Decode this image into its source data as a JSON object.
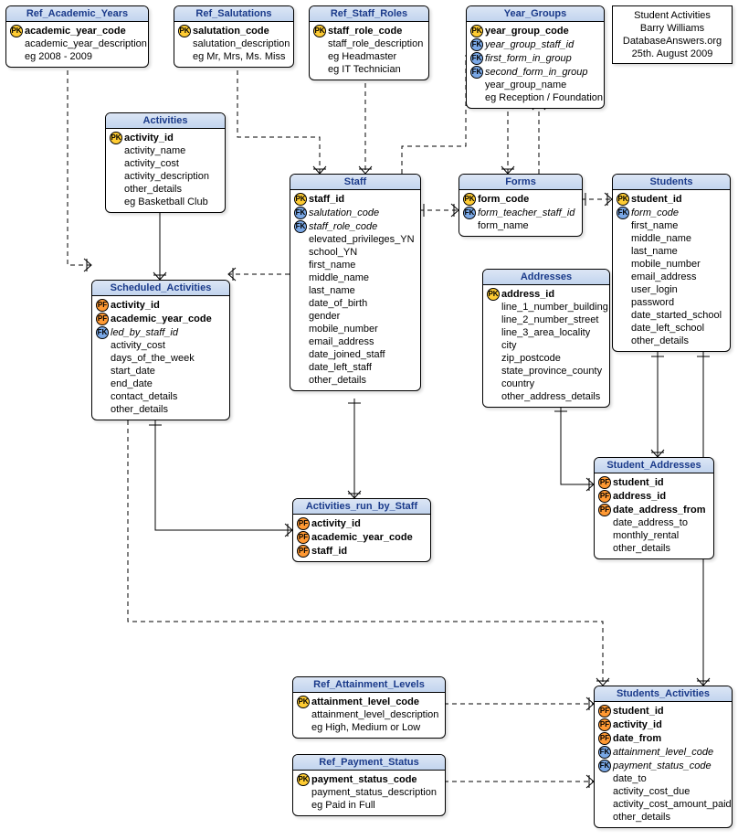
{
  "meta": {
    "line1": "Student Activities",
    "line2": "Barry Williams",
    "line3": "DatabaseAnswers.org",
    "line4": "25th. August 2009"
  },
  "entities": {
    "ref_academic_years": {
      "title": "Ref_Academic_Years",
      "fields": [
        {
          "key": "pk",
          "name": "academic_year_code",
          "bold": true
        },
        {
          "key": "",
          "name": "academic_year_description"
        },
        {
          "key": "",
          "name": "eg 2008 - 2009"
        }
      ]
    },
    "ref_salutations": {
      "title": "Ref_Salutations",
      "fields": [
        {
          "key": "pk",
          "name": "salutation_code",
          "bold": true
        },
        {
          "key": "",
          "name": "salutation_description"
        },
        {
          "key": "",
          "name": "eg Mr, Mrs, Ms. Miss"
        }
      ]
    },
    "ref_staff_roles": {
      "title": "Ref_Staff_Roles",
      "fields": [
        {
          "key": "pk",
          "name": "staff_role_code",
          "bold": true
        },
        {
          "key": "",
          "name": "staff_role_description"
        },
        {
          "key": "",
          "name": "eg Headmaster"
        },
        {
          "key": "",
          "name": "eg IT Technician"
        }
      ]
    },
    "year_groups": {
      "title": "Year_Groups",
      "fields": [
        {
          "key": "pk",
          "name": "year_group_code",
          "bold": true
        },
        {
          "key": "fk",
          "name": "year_group_staff_id",
          "italic": true
        },
        {
          "key": "fk",
          "name": "first_form_in_group",
          "italic": true
        },
        {
          "key": "fk",
          "name": "second_form_in_group",
          "italic": true
        },
        {
          "key": "",
          "name": "year_group_name"
        },
        {
          "key": "",
          "name": "eg Reception / Foundation"
        }
      ]
    },
    "activities": {
      "title": "Activities",
      "fields": [
        {
          "key": "pk",
          "name": "activity_id",
          "bold": true
        },
        {
          "key": "",
          "name": "activity_name"
        },
        {
          "key": "",
          "name": "activity_cost"
        },
        {
          "key": "",
          "name": "activity_description"
        },
        {
          "key": "",
          "name": "other_details"
        },
        {
          "key": "",
          "name": "eg Basketball Club"
        }
      ]
    },
    "staff": {
      "title": "Staff",
      "fields": [
        {
          "key": "pk",
          "name": "staff_id",
          "bold": true
        },
        {
          "key": "fk",
          "name": "salutation_code",
          "italic": true
        },
        {
          "key": "fk",
          "name": "staff_role_code",
          "italic": true
        },
        {
          "key": "",
          "name": "elevated_privileges_YN"
        },
        {
          "key": "",
          "name": "school_YN"
        },
        {
          "key": "",
          "name": "first_name"
        },
        {
          "key": "",
          "name": "middle_name"
        },
        {
          "key": "",
          "name": "last_name"
        },
        {
          "key": "",
          "name": "date_of_birth"
        },
        {
          "key": "",
          "name": "gender"
        },
        {
          "key": "",
          "name": "mobile_number"
        },
        {
          "key": "",
          "name": "email_address"
        },
        {
          "key": "",
          "name": "date_joined_staff"
        },
        {
          "key": "",
          "name": "date_left_staff"
        },
        {
          "key": "",
          "name": "other_details"
        }
      ]
    },
    "forms": {
      "title": "Forms",
      "fields": [
        {
          "key": "pk",
          "name": "form_code",
          "bold": true
        },
        {
          "key": "fk",
          "name": "form_teacher_staff_id",
          "italic": true
        },
        {
          "key": "",
          "name": "form_name"
        }
      ]
    },
    "students": {
      "title": "Students",
      "fields": [
        {
          "key": "pk",
          "name": "student_id",
          "bold": true
        },
        {
          "key": "fk",
          "name": "form_code",
          "italic": true
        },
        {
          "key": "",
          "name": "first_name"
        },
        {
          "key": "",
          "name": "middle_name"
        },
        {
          "key": "",
          "name": "last_name"
        },
        {
          "key": "",
          "name": "mobile_number"
        },
        {
          "key": "",
          "name": "email_address"
        },
        {
          "key": "",
          "name": "user_login"
        },
        {
          "key": "",
          "name": "password"
        },
        {
          "key": "",
          "name": "date_started_school"
        },
        {
          "key": "",
          "name": "date_left_school"
        },
        {
          "key": "",
          "name": "other_details"
        }
      ]
    },
    "addresses": {
      "title": "Addresses",
      "fields": [
        {
          "key": "pk",
          "name": "address_id",
          "bold": true
        },
        {
          "key": "",
          "name": "line_1_number_building"
        },
        {
          "key": "",
          "name": "line_2_number_street"
        },
        {
          "key": "",
          "name": "line_3_area_locality"
        },
        {
          "key": "",
          "name": "city"
        },
        {
          "key": "",
          "name": "zip_postcode"
        },
        {
          "key": "",
          "name": "state_province_county"
        },
        {
          "key": "",
          "name": "country"
        },
        {
          "key": "",
          "name": "other_address_details"
        }
      ]
    },
    "scheduled_activities": {
      "title": "Scheduled_Activities",
      "fields": [
        {
          "key": "pf",
          "name": "activity_id",
          "bold": true
        },
        {
          "key": "pf",
          "name": "academic_year_code",
          "bold": true
        },
        {
          "key": "fk",
          "name": "led_by_staff_id",
          "italic": true
        },
        {
          "key": "",
          "name": "activity_cost"
        },
        {
          "key": "",
          "name": "days_of_the_week"
        },
        {
          "key": "",
          "name": "start_date"
        },
        {
          "key": "",
          "name": "end_date"
        },
        {
          "key": "",
          "name": "contact_details"
        },
        {
          "key": "",
          "name": "other_details"
        }
      ]
    },
    "activities_run_by_staff": {
      "title": "Activities_run_by_Staff",
      "fields": [
        {
          "key": "pf",
          "name": "activity_id",
          "bold": true
        },
        {
          "key": "pf",
          "name": "academic_year_code",
          "bold": true
        },
        {
          "key": "pf",
          "name": "staff_id",
          "bold": true
        }
      ]
    },
    "student_addresses": {
      "title": "Student_Addresses",
      "fields": [
        {
          "key": "pf",
          "name": "student_id",
          "bold": true
        },
        {
          "key": "pf",
          "name": "address_id",
          "bold": true
        },
        {
          "key": "pf",
          "name": "date_address_from",
          "bold": true
        },
        {
          "key": "",
          "name": "date_address_to"
        },
        {
          "key": "",
          "name": "monthly_rental"
        },
        {
          "key": "",
          "name": "other_details"
        }
      ]
    },
    "ref_attainment_levels": {
      "title": "Ref_Attainment_Levels",
      "fields": [
        {
          "key": "pk",
          "name": "attainment_level_code",
          "bold": true
        },
        {
          "key": "",
          "name": "attainment_level_description"
        },
        {
          "key": "",
          "name": "eg High, Medium or Low"
        }
      ]
    },
    "ref_payment_status": {
      "title": "Ref_Payment_Status",
      "fields": [
        {
          "key": "pk",
          "name": "payment_status_code",
          "bold": true
        },
        {
          "key": "",
          "name": "payment_status_description"
        },
        {
          "key": "",
          "name": "eg Paid in Full"
        }
      ]
    },
    "students_activities": {
      "title": "Students_Activities",
      "fields": [
        {
          "key": "pf",
          "name": "student_id",
          "bold": true
        },
        {
          "key": "pf",
          "name": "activity_id",
          "bold": true
        },
        {
          "key": "pf",
          "name": "date_from",
          "bold": true
        },
        {
          "key": "fk",
          "name": "attainment_level_code",
          "italic": true
        },
        {
          "key": "fk",
          "name": "payment_status_code",
          "italic": true
        },
        {
          "key": "",
          "name": "date_to"
        },
        {
          "key": "",
          "name": "activity_cost_due"
        },
        {
          "key": "",
          "name": "activity_cost_amount_paid"
        },
        {
          "key": "",
          "name": "other_details"
        }
      ]
    }
  }
}
